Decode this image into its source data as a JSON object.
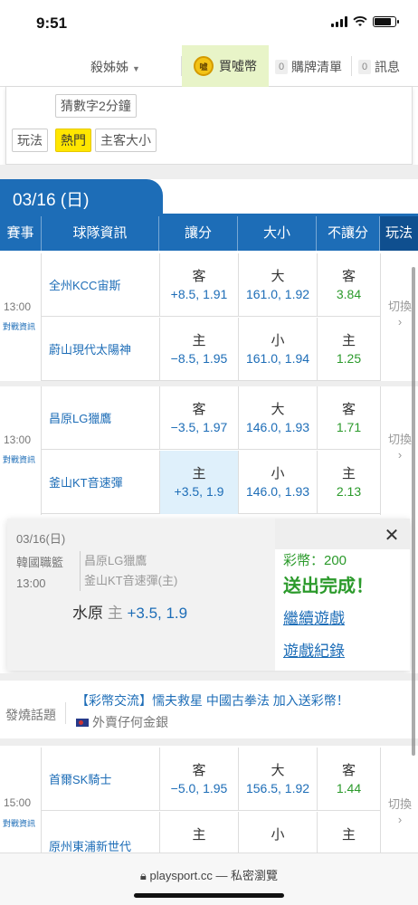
{
  "status": {
    "time": "9:51"
  },
  "nav": {
    "user": "殺姊姊",
    "buy_label": "買噓幣",
    "coin_text": "噓",
    "cart_count": "0",
    "cart_label": "購牌清單",
    "msg_count": "0",
    "msg_label": "訊息"
  },
  "panel": {
    "guess_tag": "猜數字2分鐘",
    "play_label": "玩法",
    "hot_tag": "熱門",
    "home_away_tag": "主客大小"
  },
  "date_header": "03/16 (日)",
  "table_header": {
    "event": "賽事",
    "team_info": "球隊資訊",
    "spread": "讓分",
    "total": "大小",
    "moneyline": "不讓分",
    "play": "玩法"
  },
  "matches": [
    {
      "time": "13:00",
      "info": "對戰資訊",
      "switch": "切換",
      "rows": [
        {
          "team": "全州KCC宙斯",
          "spread_k": "客",
          "spread_v": "+8.5, 1.91",
          "total_k": "大",
          "total_v": "161.0, 1.92",
          "ml_k": "客",
          "ml_v": "3.84"
        },
        {
          "team": "蔚山現代太陽神",
          "spread_k": "主",
          "spread_v": "−8.5, 1.95",
          "total_k": "小",
          "total_v": "161.0, 1.94",
          "ml_k": "主",
          "ml_v": "1.25"
        }
      ]
    },
    {
      "time": "13:00",
      "info": "對戰資訊",
      "switch": "切換",
      "rows": [
        {
          "team": "昌原LG獵鷹",
          "spread_k": "客",
          "spread_v": "−3.5, 1.97",
          "total_k": "大",
          "total_v": "146.0, 1.93",
          "ml_k": "客",
          "ml_v": "1.71"
        },
        {
          "team": "釜山KT音速彈",
          "spread_k": "主",
          "spread_v": "+3.5, 1.9",
          "total_k": "小",
          "total_v": "146.0, 1.93",
          "ml_k": "主",
          "ml_v": "2.13"
        }
      ]
    },
    {
      "time": "15:00",
      "info": "對戰資訊",
      "switch": "切換",
      "rows": [
        {
          "team": "首爾SK騎士",
          "spread_k": "客",
          "spread_v": "−5.0, 1.95",
          "total_k": "大",
          "total_v": "156.5, 1.92",
          "ml_k": "客",
          "ml_v": "1.44"
        },
        {
          "team": "原州東浦新世代",
          "spread_k": "主",
          "spread_v": "",
          "total_k": "小",
          "total_v": "",
          "ml_k": "主",
          "ml_v": ""
        }
      ]
    }
  ],
  "popup": {
    "date": "03/16(日)",
    "league": "韓國職籃",
    "time": "13:00",
    "team_away": "昌原LG獵鷹",
    "team_home": "釜山KT音速彈(主)",
    "pick_team": "水原",
    "pick_side": "主",
    "pick_odds": "+3.5, 1.9",
    "coins": "彩幣：200",
    "done": "送出完成！",
    "continue": "繼續遊戲",
    "history": "遊戲紀錄",
    "close": "✕"
  },
  "news": {
    "label": "發燒話題",
    "headline": "【彩幣交流】懦夫救星 中國古拳法 加入送彩幣！",
    "author": "外賣仔何金銀"
  },
  "browser": {
    "url": "playsport.cc — 私密瀏覽"
  }
}
